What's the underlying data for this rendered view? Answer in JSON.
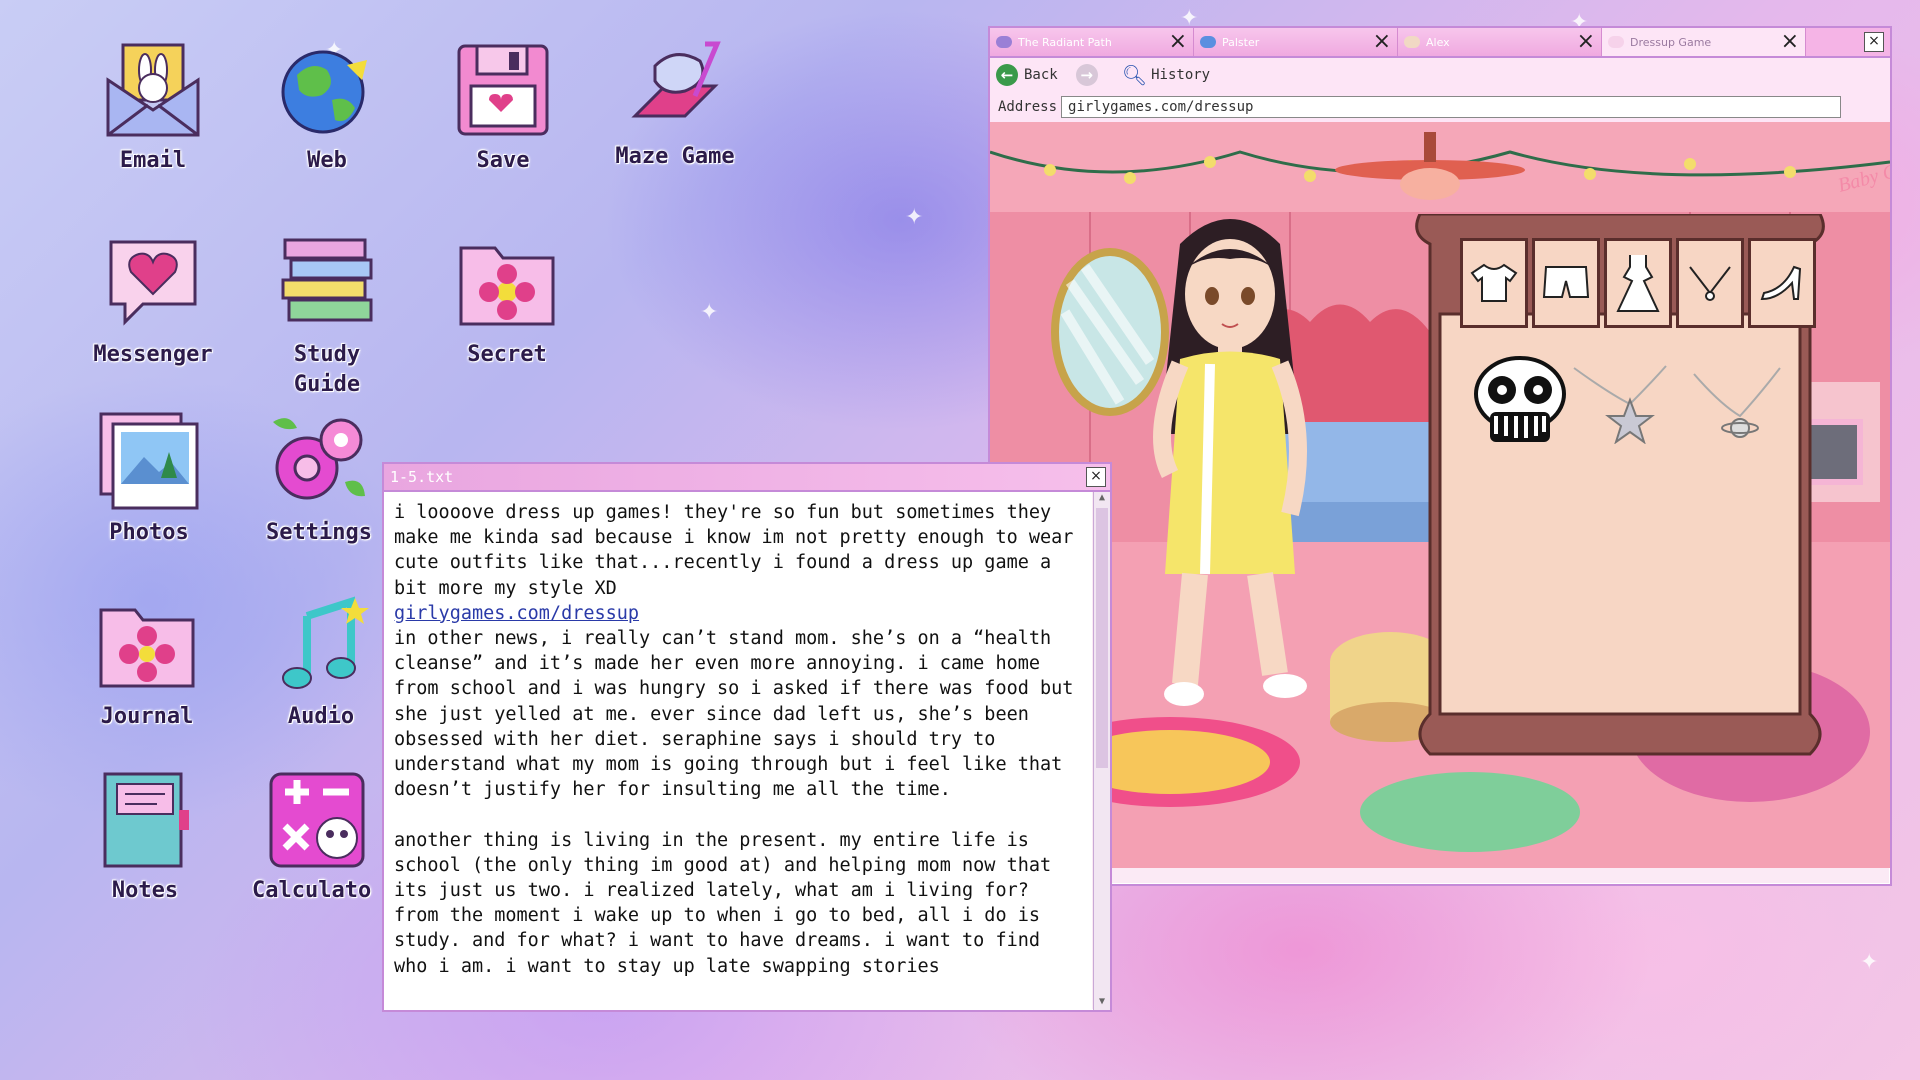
{
  "desktop": {
    "icons": [
      {
        "label": "Email"
      },
      {
        "label": "Web"
      },
      {
        "label": "Save"
      },
      {
        "label": "Maze Game"
      },
      {
        "label": "Messenger"
      },
      {
        "label": "Study\nGuide"
      },
      {
        "label": "Secret"
      },
      {
        "label": "Photos"
      },
      {
        "label": "Settings"
      },
      {
        "label": "Journal"
      },
      {
        "label": "Audio"
      },
      {
        "label": "Notes"
      },
      {
        "label": "Calculato"
      }
    ]
  },
  "text_window": {
    "title": "1-5.txt",
    "close": "×",
    "para1": "i loooove dress up games! they're so fun but sometimes they make me kinda sad because i know im not pretty enough to wear cute outfits like that...recently i found a dress up game a bit more my style XD",
    "link": "girlygames.com/dressup",
    "para2": "in other news, i really can’t stand mom. she’s on a “health cleanse” and it’s made her even more annoying. i came home from school and i was hungry so i asked if there was food but she just yelled at me. ever since dad left us, she’s been obsessed with her diet. seraphine says i should try to understand what my mom is going through but i feel like that doesn’t justify her for insulting me all the time.",
    "para3": "another thing is living in the present. my entire life is school (the only thing im good at) and helping mom now that its just us two. i realized lately, what am i living for? from the moment i wake up to when i go to bed, all i do is study. and for what? i want to have dreams. i want to find who i am. i want to stay up late swapping stories"
  },
  "browser": {
    "tabs": [
      {
        "name": "The Radiant Path",
        "icon_color": "#9a7fd6",
        "active": false
      },
      {
        "name": "Palster",
        "icon_color": "#5a8fe0",
        "active": false
      },
      {
        "name": "Alex",
        "icon_color": "#f1d9c4",
        "active": false
      },
      {
        "name": "Dressup Game",
        "icon_color": "#f6d2ea",
        "active": true
      }
    ],
    "tab_close": "×",
    "window_close": "×",
    "back_label": "Back",
    "history_label": "History",
    "address_label": "Address",
    "address_value": "girlygames.com/dressup",
    "game": {
      "wardrobe_categories": [
        "shirt-icon",
        "shorts-icon",
        "dress-icon",
        "necklace-icon",
        "heel-icon"
      ],
      "items": [
        "skull-mask",
        "star-necklace",
        "planet-necklace"
      ],
      "poster_text": "Baby Girl"
    }
  }
}
